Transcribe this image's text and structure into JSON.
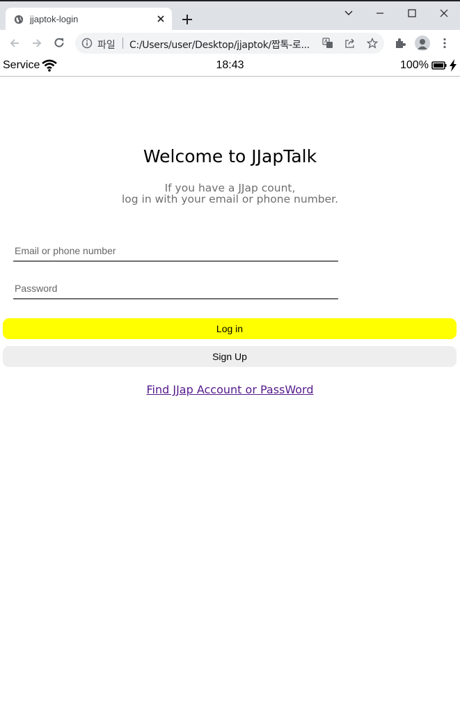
{
  "browser": {
    "tab_title": "jjaptok-login",
    "omnibox_scheme": "파일",
    "url": "C:/Users/user/Desktop/jjaptok/짭톡-로..."
  },
  "status_bar": {
    "carrier": "Service",
    "time": "18:43",
    "battery": "100%"
  },
  "login": {
    "title": "Welcome to JJapTalk",
    "subtitle_line1": "If you have a JJap count,",
    "subtitle_line2": "log in with your email or phone number.",
    "email_placeholder": "Email or phone number",
    "password_placeholder": "Password",
    "login_label": "Log in",
    "signup_label": "Sign Up",
    "find_link": "Find JJap Account or PassWord"
  },
  "colors": {
    "login_button": "#ffff00",
    "signup_button": "#eeeeee",
    "link": "#551a8b"
  },
  "icons": [
    "globe-icon",
    "close-icon",
    "plus-icon",
    "chevron-down-icon",
    "minimize-icon",
    "maximize-icon",
    "window-close-icon",
    "back-icon",
    "forward-icon",
    "reload-icon",
    "info-icon",
    "translate-icon",
    "share-icon",
    "star-icon",
    "extensions-icon",
    "profile-icon",
    "more-icon",
    "wifi-icon",
    "battery-icon",
    "charging-bolt-icon"
  ]
}
